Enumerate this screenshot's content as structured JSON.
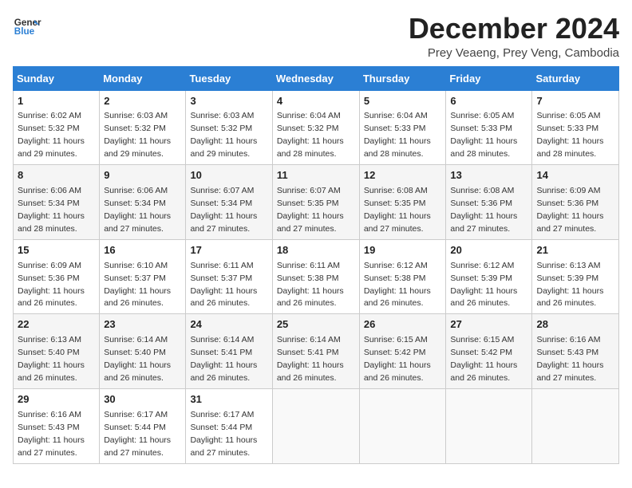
{
  "header": {
    "logo_line1": "General",
    "logo_line2": "Blue",
    "month": "December 2024",
    "location": "Prey Veaeng, Prey Veng, Cambodia"
  },
  "days_of_week": [
    "Sunday",
    "Monday",
    "Tuesday",
    "Wednesday",
    "Thursday",
    "Friday",
    "Saturday"
  ],
  "weeks": [
    [
      {
        "day": "1",
        "sunrise": "6:02 AM",
        "sunset": "5:32 PM",
        "daylight": "11 hours and 29 minutes."
      },
      {
        "day": "2",
        "sunrise": "6:03 AM",
        "sunset": "5:32 PM",
        "daylight": "11 hours and 29 minutes."
      },
      {
        "day": "3",
        "sunrise": "6:03 AM",
        "sunset": "5:32 PM",
        "daylight": "11 hours and 29 minutes."
      },
      {
        "day": "4",
        "sunrise": "6:04 AM",
        "sunset": "5:32 PM",
        "daylight": "11 hours and 28 minutes."
      },
      {
        "day": "5",
        "sunrise": "6:04 AM",
        "sunset": "5:33 PM",
        "daylight": "11 hours and 28 minutes."
      },
      {
        "day": "6",
        "sunrise": "6:05 AM",
        "sunset": "5:33 PM",
        "daylight": "11 hours and 28 minutes."
      },
      {
        "day": "7",
        "sunrise": "6:05 AM",
        "sunset": "5:33 PM",
        "daylight": "11 hours and 28 minutes."
      }
    ],
    [
      {
        "day": "8",
        "sunrise": "6:06 AM",
        "sunset": "5:34 PM",
        "daylight": "11 hours and 28 minutes."
      },
      {
        "day": "9",
        "sunrise": "6:06 AM",
        "sunset": "5:34 PM",
        "daylight": "11 hours and 27 minutes."
      },
      {
        "day": "10",
        "sunrise": "6:07 AM",
        "sunset": "5:34 PM",
        "daylight": "11 hours and 27 minutes."
      },
      {
        "day": "11",
        "sunrise": "6:07 AM",
        "sunset": "5:35 PM",
        "daylight": "11 hours and 27 minutes."
      },
      {
        "day": "12",
        "sunrise": "6:08 AM",
        "sunset": "5:35 PM",
        "daylight": "11 hours and 27 minutes."
      },
      {
        "day": "13",
        "sunrise": "6:08 AM",
        "sunset": "5:36 PM",
        "daylight": "11 hours and 27 minutes."
      },
      {
        "day": "14",
        "sunrise": "6:09 AM",
        "sunset": "5:36 PM",
        "daylight": "11 hours and 27 minutes."
      }
    ],
    [
      {
        "day": "15",
        "sunrise": "6:09 AM",
        "sunset": "5:36 PM",
        "daylight": "11 hours and 26 minutes."
      },
      {
        "day": "16",
        "sunrise": "6:10 AM",
        "sunset": "5:37 PM",
        "daylight": "11 hours and 26 minutes."
      },
      {
        "day": "17",
        "sunrise": "6:11 AM",
        "sunset": "5:37 PM",
        "daylight": "11 hours and 26 minutes."
      },
      {
        "day": "18",
        "sunrise": "6:11 AM",
        "sunset": "5:38 PM",
        "daylight": "11 hours and 26 minutes."
      },
      {
        "day": "19",
        "sunrise": "6:12 AM",
        "sunset": "5:38 PM",
        "daylight": "11 hours and 26 minutes."
      },
      {
        "day": "20",
        "sunrise": "6:12 AM",
        "sunset": "5:39 PM",
        "daylight": "11 hours and 26 minutes."
      },
      {
        "day": "21",
        "sunrise": "6:13 AM",
        "sunset": "5:39 PM",
        "daylight": "11 hours and 26 minutes."
      }
    ],
    [
      {
        "day": "22",
        "sunrise": "6:13 AM",
        "sunset": "5:40 PM",
        "daylight": "11 hours and 26 minutes."
      },
      {
        "day": "23",
        "sunrise": "6:14 AM",
        "sunset": "5:40 PM",
        "daylight": "11 hours and 26 minutes."
      },
      {
        "day": "24",
        "sunrise": "6:14 AM",
        "sunset": "5:41 PM",
        "daylight": "11 hours and 26 minutes."
      },
      {
        "day": "25",
        "sunrise": "6:14 AM",
        "sunset": "5:41 PM",
        "daylight": "11 hours and 26 minutes."
      },
      {
        "day": "26",
        "sunrise": "6:15 AM",
        "sunset": "5:42 PM",
        "daylight": "11 hours and 26 minutes."
      },
      {
        "day": "27",
        "sunrise": "6:15 AM",
        "sunset": "5:42 PM",
        "daylight": "11 hours and 26 minutes."
      },
      {
        "day": "28",
        "sunrise": "6:16 AM",
        "sunset": "5:43 PM",
        "daylight": "11 hours and 27 minutes."
      }
    ],
    [
      {
        "day": "29",
        "sunrise": "6:16 AM",
        "sunset": "5:43 PM",
        "daylight": "11 hours and 27 minutes."
      },
      {
        "day": "30",
        "sunrise": "6:17 AM",
        "sunset": "5:44 PM",
        "daylight": "11 hours and 27 minutes."
      },
      {
        "day": "31",
        "sunrise": "6:17 AM",
        "sunset": "5:44 PM",
        "daylight": "11 hours and 27 minutes."
      },
      null,
      null,
      null,
      null
    ]
  ]
}
